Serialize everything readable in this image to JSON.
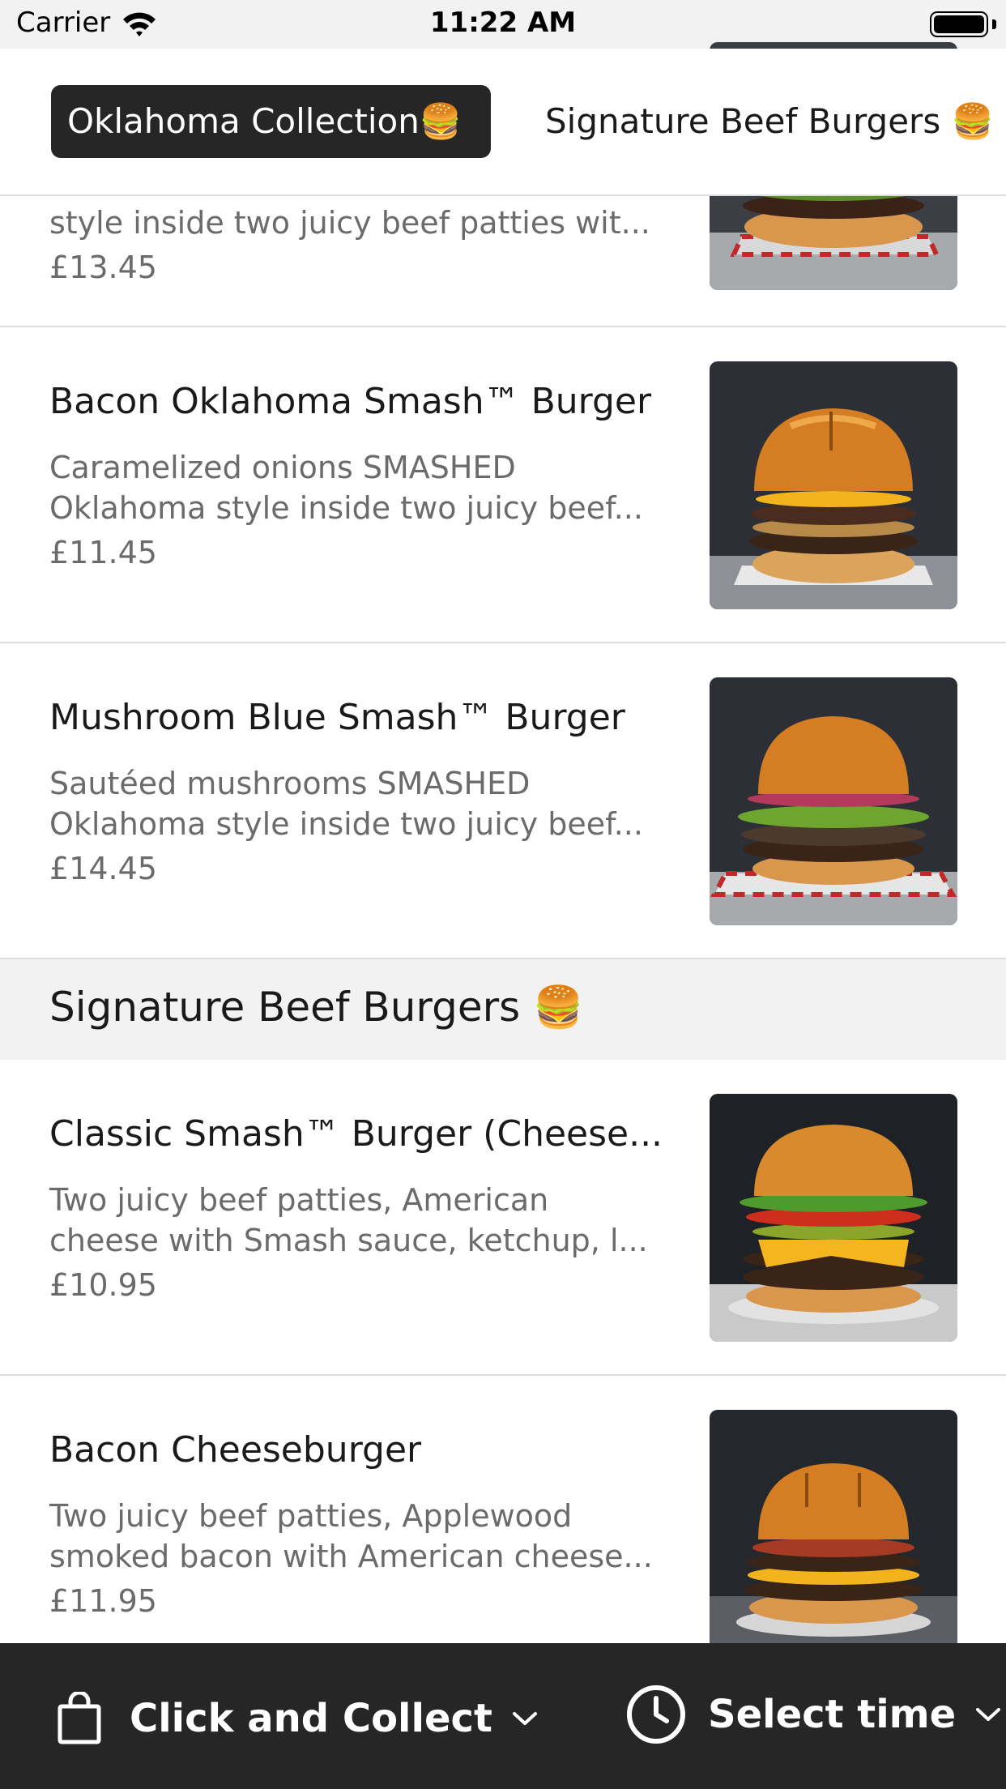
{
  "status": {
    "carrier": "Carrier",
    "time": "11:22 AM"
  },
  "tabs": [
    {
      "label": "Oklahoma Collection🍔"
    },
    {
      "label": "Signature Beef Burgers 🍔"
    }
  ],
  "items": [
    {
      "title": "",
      "desc": "style inside two juicy beef patties wit...",
      "price": "£13.45"
    },
    {
      "title": "Bacon Oklahoma Smash™ Burger",
      "desc": "Caramelized onions SMASHED\nOklahoma style inside two juicy beef...",
      "price": "£11.45"
    },
    {
      "title": "Mushroom Blue Smash™ Burger",
      "desc": "Sautéed mushrooms SMASHED\nOklahoma style inside two juicy beef...",
      "price": "£14.45"
    },
    {
      "title": "Classic Smash™ Burger (Cheese...",
      "desc": "Two juicy beef patties, American\ncheese with Smash sauce, ketchup, l...",
      "price": "£10.95"
    },
    {
      "title": "Bacon Cheeseburger",
      "desc": "Two juicy beef patties, Applewood\nsmoked bacon with American cheese...",
      "price": "£11.95"
    }
  ],
  "section": {
    "title": "Signature Beef Burgers 🍔"
  },
  "bottom": {
    "collect_label": "Click and Collect",
    "time_label": "Select time"
  },
  "colors": {
    "dark_bar": "#262626",
    "section_bg": "#f2f2f2",
    "muted_text": "#6b6b6b"
  }
}
